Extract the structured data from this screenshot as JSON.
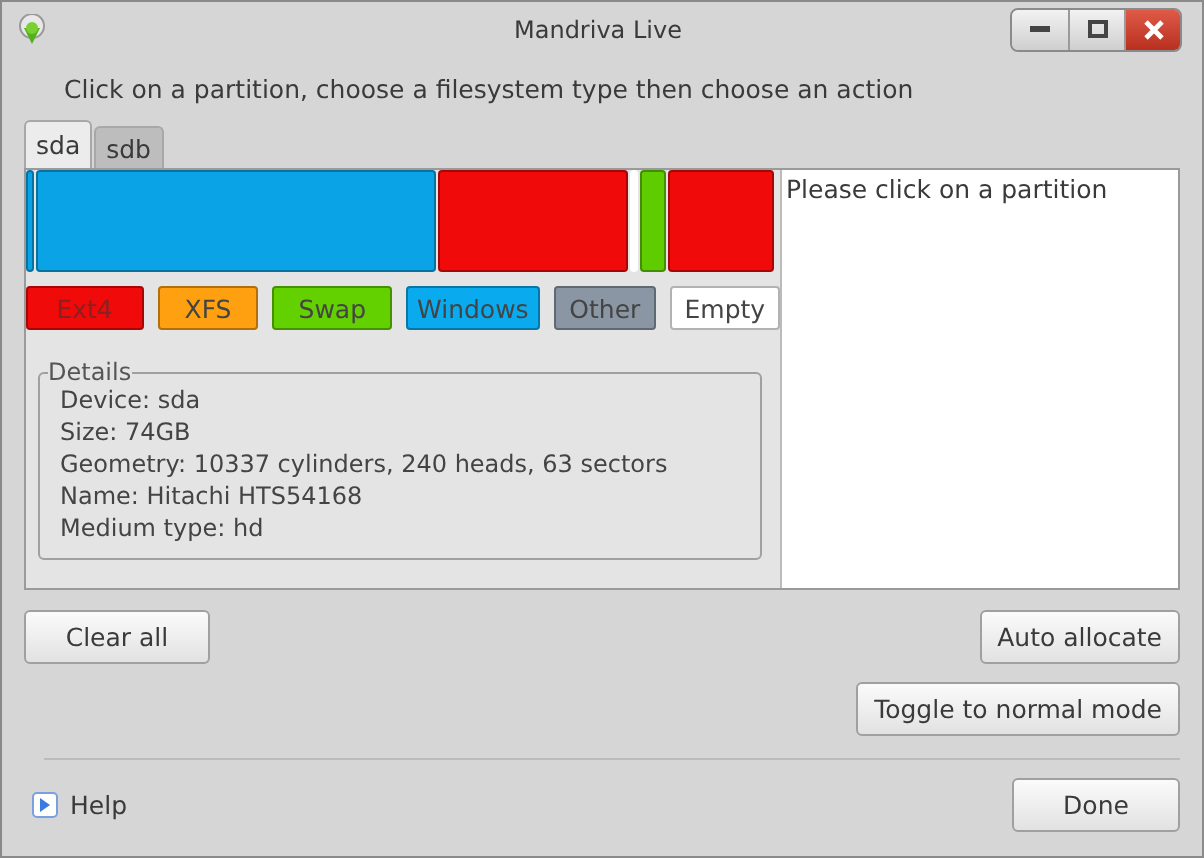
{
  "window": {
    "title": "Mandriva Live"
  },
  "instruction": "Click on a partition, choose a filesystem type then choose an action",
  "tabs": [
    {
      "label": "sda",
      "selected": true
    },
    {
      "label": "sdb",
      "selected": false
    }
  ],
  "partitions": [
    {
      "color": "#0aa4e6"
    },
    {
      "color": "#0aa4e6"
    },
    {
      "color": "#f00a0a"
    },
    {
      "color": "#ffffff"
    },
    {
      "color": "#5fcc00"
    },
    {
      "color": "#f00a0a"
    }
  ],
  "fs_types": [
    {
      "label": "Ext4",
      "color": "#f00a0a"
    },
    {
      "label": "XFS",
      "color": "#ffa010"
    },
    {
      "label": "Swap",
      "color": "#63d000"
    },
    {
      "label": "Windows",
      "color": "#0aaaee"
    },
    {
      "label": "Other",
      "color": "#8a96a4"
    },
    {
      "label": "Empty",
      "color": "#ffffff"
    }
  ],
  "info": "Please click on a partition",
  "details": {
    "title": "Details",
    "lines": [
      "Device: sda",
      "Size: 74GB",
      "Geometry: 10337 cylinders, 240 heads, 63 sectors",
      "Name: Hitachi HTS54168",
      "Medium type: hd"
    ]
  },
  "buttons": {
    "clear": "Clear all",
    "auto": "Auto allocate",
    "toggle": "Toggle to normal mode",
    "done": "Done"
  },
  "help": {
    "label": "Help",
    "expanded": false
  }
}
